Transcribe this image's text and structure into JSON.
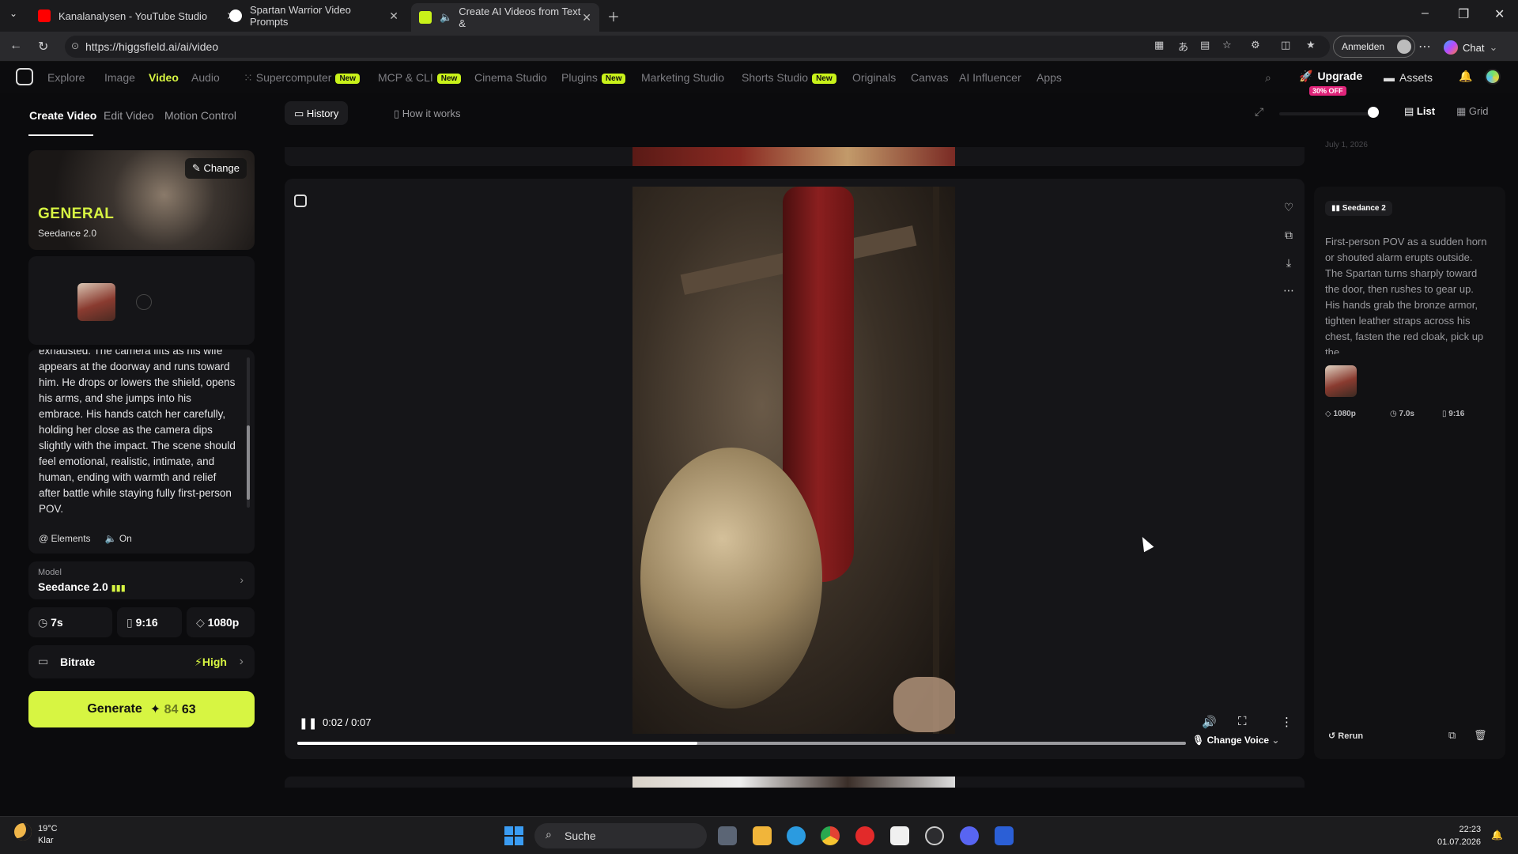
{
  "browser": {
    "tabs": [
      {
        "title": "Kanalanalysen - YouTube Studio",
        "favicon_color": "#ff0000"
      },
      {
        "title": "Spartan Warrior Video Prompts",
        "favicon_color": "#ffffff"
      },
      {
        "title": "Create AI Videos from Text &",
        "favicon_color": "#c9f21a",
        "active": true
      }
    ],
    "url": "https://higgsfield.ai/ai/video",
    "signin_label": "Anmelden",
    "chat_label": "Chat"
  },
  "nav": {
    "items": [
      "Explore",
      "Image",
      "Video",
      "Audio",
      "Supercomputer",
      "MCP & CLI",
      "Cinema Studio",
      "Plugins",
      "Marketing Studio",
      "Shorts Studio",
      "Originals",
      "Canvas",
      "AI Influencer",
      "Apps"
    ],
    "active": "Video",
    "new_badge": "New",
    "upgrade": "Upgrade",
    "upgrade_badge": "30% OFF",
    "assets": "Assets"
  },
  "left": {
    "tabs": [
      "Create Video",
      "Edit Video",
      "Motion Control"
    ],
    "preset_title": "GENERAL",
    "preset_model": "Seedance 2.0",
    "change_label": "Change",
    "prompt": "exhausted. The camera lifts as his wife appears at the doorway and runs toward him. He drops or lowers the shield, opens his arms, and she jumps into his embrace. His hands catch her carefully, holding her close as the camera dips slightly with the impact. The scene should feel emotional, realistic, intimate, and human, ending with warmth and relief after battle while staying fully first-person POV.",
    "elements_label": "Elements",
    "sound_label": "On",
    "model_label": "Model",
    "model_value": "Seedance 2.0",
    "duration": "7s",
    "aspect": "9:16",
    "resolution": "1080p",
    "bitrate_label": "Bitrate",
    "bitrate_value": "High",
    "generate_label": "Generate",
    "cost_old": "84",
    "cost_new": "63"
  },
  "center": {
    "tabs": [
      "History",
      "How it works"
    ],
    "view_list": "List",
    "view_grid": "Grid",
    "time": "0:02 / 0:07",
    "progress": 0.45,
    "change_voice": "Change Voice"
  },
  "right": {
    "date": "July 1, 2026",
    "model_tag": "Seedance 2",
    "prompt": "First-person POV as a sudden horn or shouted alarm erupts outside. The Spartan turns sharply toward the door, then rushes to gear up. His hands grab the bronze armor, tighten leather straps across his chest, fasten the red cloak, pick up the",
    "resolution": "1080p",
    "duration": "7.0s",
    "aspect": "9:16",
    "rerun": "Rerun"
  },
  "taskbar": {
    "temp": "19°C",
    "weather": "Klar",
    "search": "Suche",
    "time": "22:23",
    "date": "01.07.2026"
  }
}
